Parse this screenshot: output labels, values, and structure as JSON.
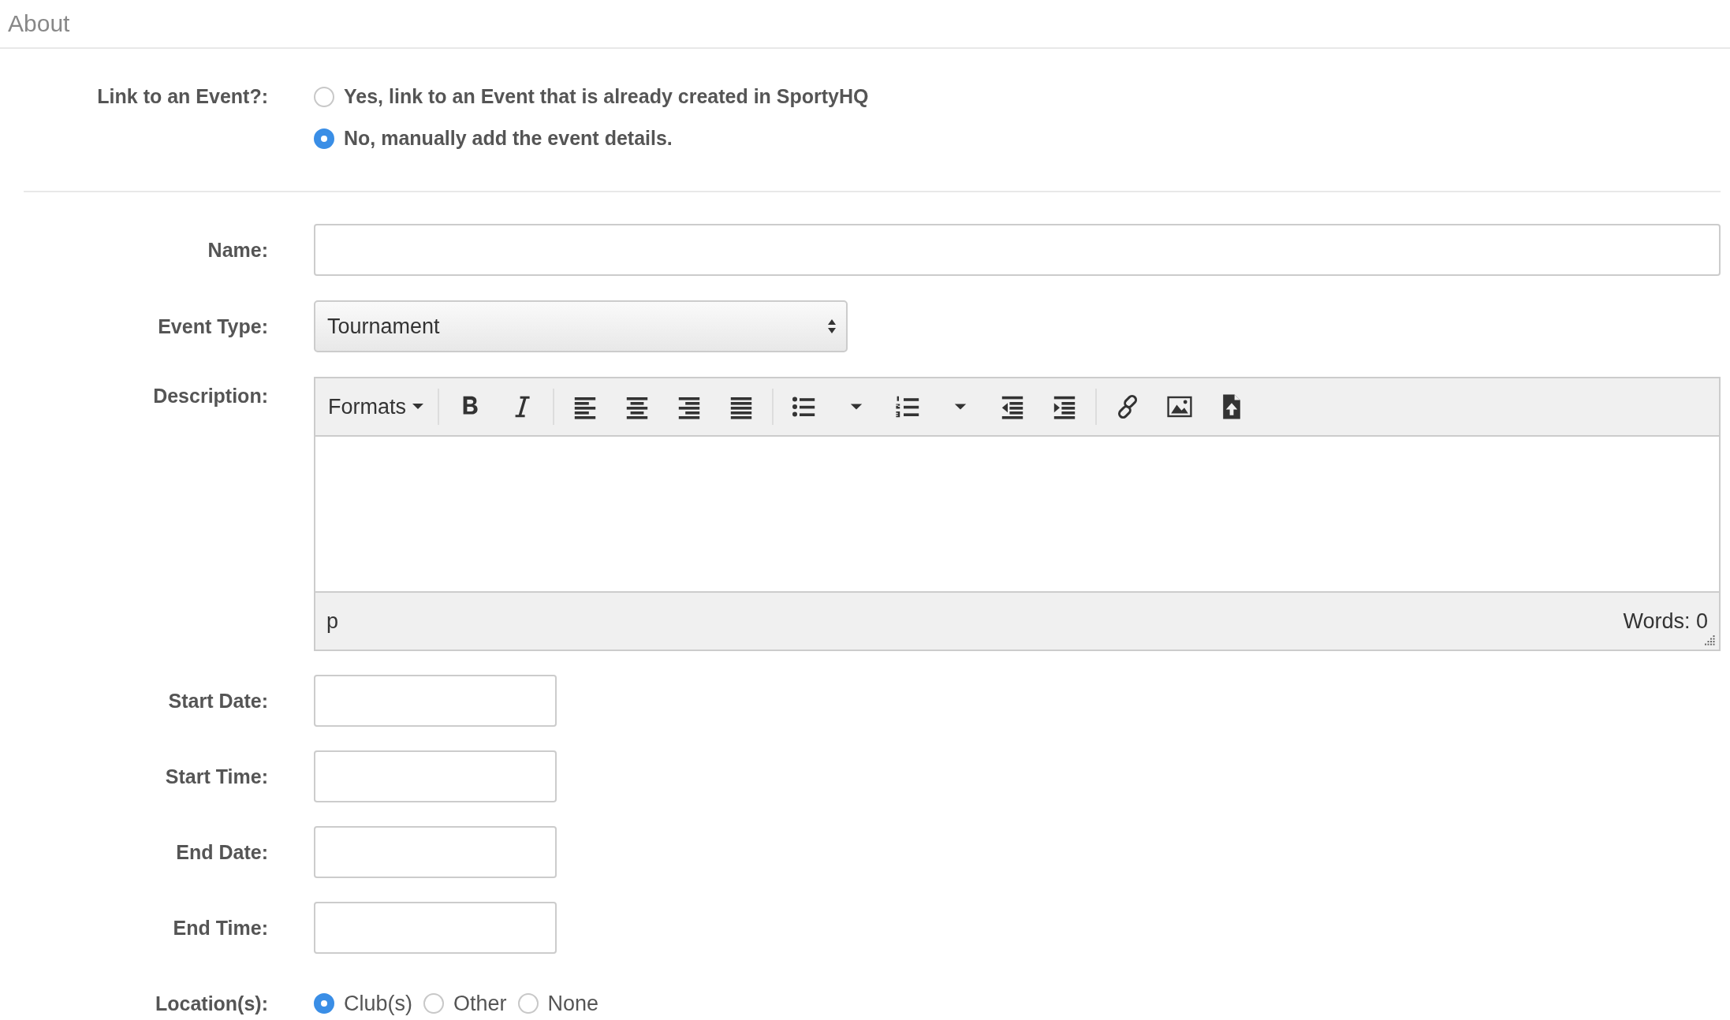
{
  "section_title": "About",
  "link_event": {
    "label": "Link to an Event?:",
    "options": [
      {
        "label": "Yes, link to an Event that is already created in SportyHQ",
        "selected": false
      },
      {
        "label": "No, manually add the event details.",
        "selected": true
      }
    ]
  },
  "name": {
    "label": "Name:"
  },
  "event_type": {
    "label": "Event Type:",
    "value": "Tournament"
  },
  "description": {
    "label": "Description:",
    "toolbar": {
      "formats": "Formats"
    },
    "status_path": "p",
    "word_count": "Words: 0"
  },
  "date_fields": [
    {
      "label": "Start Date:"
    },
    {
      "label": "Start Time:"
    },
    {
      "label": "End Date:"
    },
    {
      "label": "End Time:"
    }
  ],
  "location": {
    "label": "Location(s):",
    "options": [
      {
        "label": "Club(s)",
        "selected": true
      },
      {
        "label": "Other",
        "selected": false
      },
      {
        "label": "None",
        "selected": false
      }
    ]
  }
}
